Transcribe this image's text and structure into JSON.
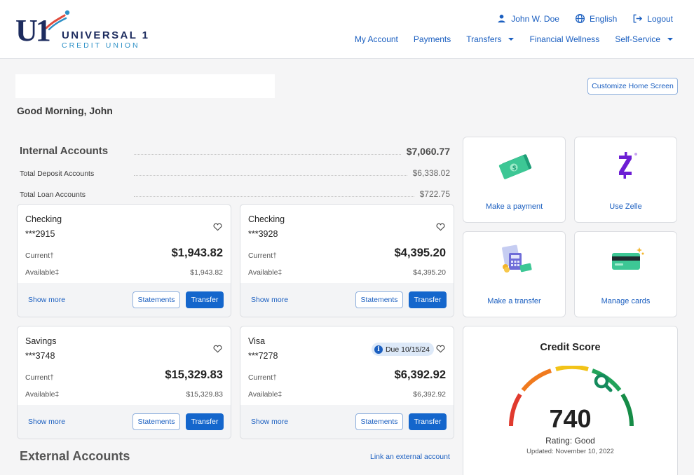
{
  "logo": {
    "mark": "U1",
    "name": "UNIVERSAL 1",
    "sub": "CREDIT UNION"
  },
  "topnav": {
    "user": "John W. Doe",
    "language": "English",
    "logout": "Logout"
  },
  "mainnav": [
    {
      "label": "My Account",
      "dropdown": false
    },
    {
      "label": "Payments",
      "dropdown": false
    },
    {
      "label": "Transfers",
      "dropdown": true
    },
    {
      "label": "Financial Wellness",
      "dropdown": false
    },
    {
      "label": "Self-Service",
      "dropdown": true
    }
  ],
  "customize_label": "Customize Home Screen",
  "greeting": "Good Morning, John",
  "summary": {
    "title": "Internal Accounts",
    "total": "$7,060.77",
    "deposit_label": "Total Deposit Accounts",
    "deposit_value": "$6,338.02",
    "loan_label": "Total Loan Accounts",
    "loan_value": "$722.75"
  },
  "accounts": [
    {
      "name": "Checking",
      "number": "***2915",
      "current_label": "Current†",
      "current": "$1,943.82",
      "available_label": "Available‡",
      "available": "$1,943.82",
      "due": ""
    },
    {
      "name": "Checking",
      "number": "***3928",
      "current_label": "Current†",
      "current": "$4,395.20",
      "available_label": "Available‡",
      "available": "$4,395.20",
      "due": ""
    },
    {
      "name": "Savings",
      "number": "***3748",
      "current_label": "Current†",
      "current": "$15,329.83",
      "available_label": "Available‡",
      "available": "$15,329.83",
      "due": ""
    },
    {
      "name": "Visa",
      "number": "***7278",
      "current_label": "Current†",
      "current": "$6,392.92",
      "available_label": "Available‡",
      "available": "$6,392.92",
      "due": "Due 10/15/24"
    }
  ],
  "card_actions": {
    "show_more": "Show more",
    "statements": "Statements",
    "transfer": "Transfer"
  },
  "external": {
    "title": "External Accounts",
    "link": "Link an external account"
  },
  "tiles": [
    {
      "label": "Make a payment",
      "icon": "money-icon"
    },
    {
      "label": "Use Zelle",
      "icon": "zelle-icon"
    },
    {
      "label": "Make a transfer",
      "icon": "transfer-icon"
    },
    {
      "label": "Manage cards",
      "icon": "credit-card-icon"
    }
  ],
  "credit": {
    "title": "Credit Score",
    "score": "740",
    "rating": "Rating: Good",
    "updated": "Updated: November 10, 2022"
  },
  "colors": {
    "primary": "#1466cc",
    "link": "#1b5fc0",
    "brand_navy": "#1c2b5e",
    "brand_blue": "#2b8fc6"
  }
}
